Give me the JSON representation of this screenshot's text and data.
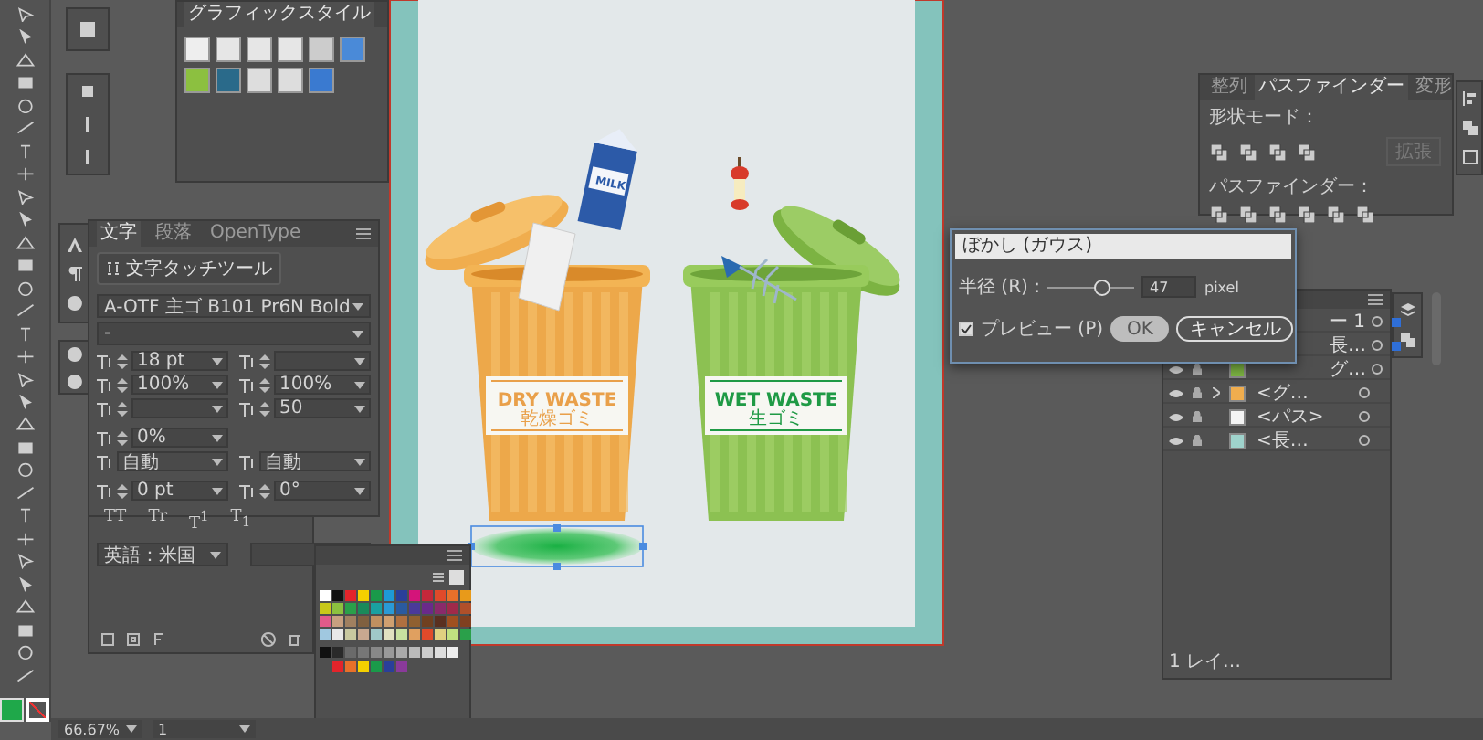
{
  "graphic_styles_panel": {
    "title": "グラフィックスタイル"
  },
  "character_panel": {
    "tabs": [
      {
        "label": "文字",
        "selected": true
      },
      {
        "label": "段落",
        "selected": false
      },
      {
        "label": "OpenType",
        "selected": false
      }
    ],
    "touch_tool": "文字タッチツール",
    "font_family": "A-OTF 主ゴ B101 Pr6N Bold",
    "font_style": "-",
    "rows": [
      [
        {
          "kind": "spin",
          "value": "18 pt"
        },
        {
          "kind": "spin"
        }
      ],
      [
        {
          "kind": "spin",
          "value": "100%"
        },
        {
          "kind": "spin",
          "value": "100%"
        }
      ],
      [
        {
          "kind": "spin"
        },
        {
          "kind": "spin",
          "value": "50"
        }
      ],
      [
        {
          "kind": "spin",
          "value": "0%"
        }
      ],
      [
        {
          "kind": "dropdown",
          "value": "自動"
        },
        {
          "kind": "dropdown",
          "value": "自動"
        }
      ],
      [
        {
          "kind": "spin",
          "value": "0 pt"
        },
        {
          "kind": "spin",
          "value": "0°"
        }
      ]
    ],
    "type_buttons": [
      "TT",
      "Tr",
      "T$^{1}$",
      "T$_{1}$"
    ],
    "language": "英語：米国"
  },
  "artwork": {
    "bins": [
      {
        "kind": "dry",
        "title": "DRY WASTE",
        "subtitle": "乾燥ゴミ"
      },
      {
        "kind": "wet",
        "title": "WET WASTE",
        "subtitle": "生ゴミ"
      }
    ],
    "milk_label": "MILK"
  },
  "dialog": {
    "title": "ぼかし (ガウス)",
    "radius_label": "半径 (R) :",
    "level": 0.62,
    "value": "47",
    "unit": "pixel",
    "preview": {
      "label": "プレビュー (P)",
      "checked": true
    },
    "buttons": [
      {
        "label": "OK",
        "kind": "default"
      },
      {
        "label": "キャンセル",
        "kind": "normal"
      }
    ]
  },
  "pathfinder_panel": {
    "tabs": [
      {
        "label": "整列",
        "selected": false
      },
      {
        "label": "パスファインダー",
        "selected": true
      },
      {
        "label": "変形",
        "selected": false
      }
    ],
    "shape_modes_label": "形状モード：",
    "expand_button": "拡張",
    "pathfinders_label": "パスファインダー："
  },
  "layers_panel": {
    "rows": [
      {
        "name": "ー 1",
        "kind": "item",
        "selected": true
      },
      {
        "name": "長…",
        "kind": "item",
        "selected": true
      },
      {
        "name": "グ…",
        "kind": "item",
        "selected": false
      },
      {
        "name": "<グ…",
        "kind": "group",
        "selected": false
      },
      {
        "name": "<パス>",
        "kind": "item",
        "selected": false
      },
      {
        "name": "<長…",
        "kind": "item",
        "selected": false
      }
    ],
    "footer": "1 レイ…"
  },
  "status_bar": {
    "zoom": "66.67%",
    "artboard": "1"
  }
}
